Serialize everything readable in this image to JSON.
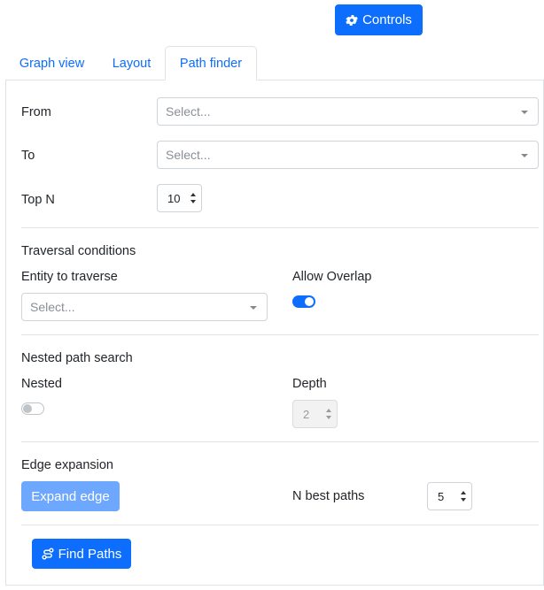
{
  "header": {
    "controls_label": "Controls",
    "controls_icon": "gear-icon"
  },
  "tabs": [
    {
      "label": "Graph view",
      "active": false
    },
    {
      "label": "Layout",
      "active": false
    },
    {
      "label": "Path finder",
      "active": true
    }
  ],
  "path_finder": {
    "from": {
      "label": "From",
      "placeholder": "Select..."
    },
    "to": {
      "label": "To",
      "placeholder": "Select..."
    },
    "top_n": {
      "label": "Top N",
      "value": "10"
    },
    "traversal": {
      "heading": "Traversal conditions",
      "entity_label": "Entity to traverse",
      "entity_placeholder": "Select...",
      "allow_overlap_label": "Allow Overlap",
      "allow_overlap": true
    },
    "nested": {
      "heading": "Nested path search",
      "nested_label": "Nested",
      "nested_enabled": false,
      "depth_label": "Depth",
      "depth_value": "2"
    },
    "edge_expansion": {
      "heading": "Edge expansion",
      "expand_label": "Expand edge",
      "n_best_label": "N best paths",
      "n_best_value": "5"
    },
    "find_paths_label": "Find Paths",
    "find_paths_icon": "route-icon"
  },
  "colors": {
    "primary": "#0d6efd",
    "primary_disabled": "#6ea8fe"
  }
}
